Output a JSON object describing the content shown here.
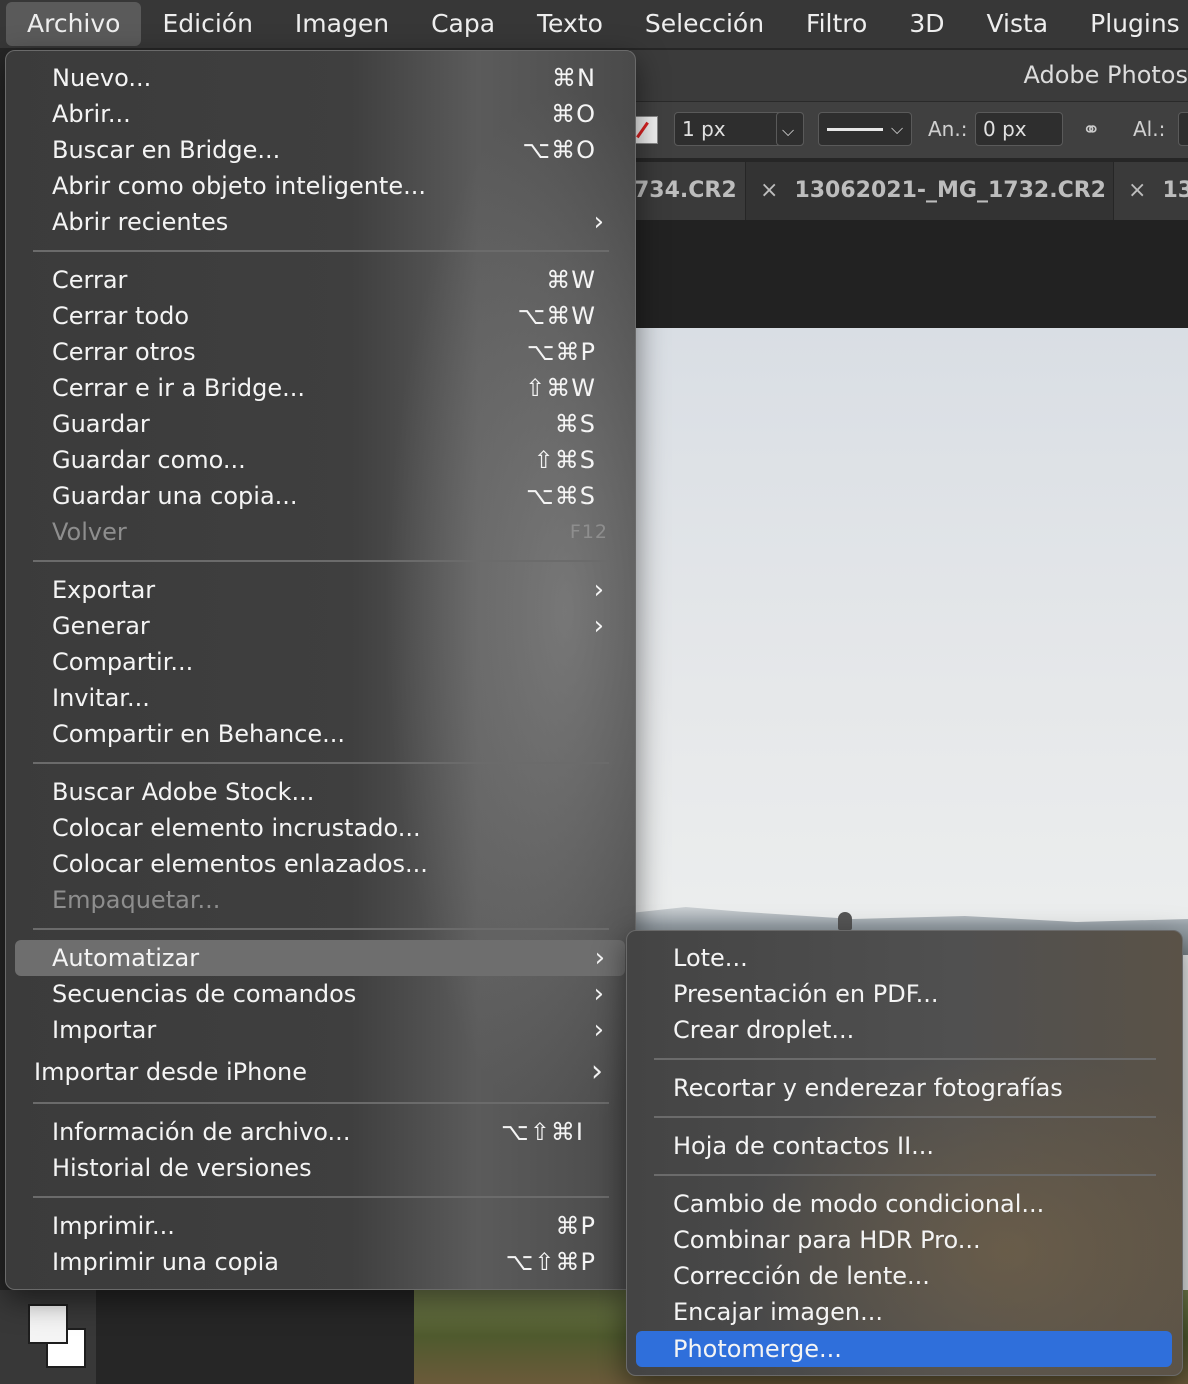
{
  "menubar": {
    "items": [
      "Archivo",
      "Edición",
      "Imagen",
      "Capa",
      "Texto",
      "Selección",
      "Filtro",
      "3D",
      "Vista",
      "Plugins"
    ],
    "active": "Archivo"
  },
  "app": {
    "title": "Adobe Photos",
    "stroke_width": "1 px",
    "width_label": "An.:",
    "width_value": "0 px",
    "height_label": "Al.:",
    "tabs": [
      {
        "close": "",
        "name": "734.CR2"
      },
      {
        "close": "×",
        "name": "13062021-_MG_1732.CR2"
      },
      {
        "close": "×",
        "name": "13"
      }
    ]
  },
  "file_menu": {
    "nuevo": {
      "label": "Nuevo...",
      "shortcut": "⌘N"
    },
    "abrir": {
      "label": "Abrir...",
      "shortcut": "⌘O"
    },
    "buscar_bridge": {
      "label": "Buscar en Bridge...",
      "shortcut": "⌥⌘O"
    },
    "abrir_inteligente": {
      "label": "Abrir como objeto inteligente..."
    },
    "abrir_recientes": {
      "label": "Abrir recientes",
      "arrow": "›"
    },
    "cerrar": {
      "label": "Cerrar",
      "shortcut": "⌘W"
    },
    "cerrar_todo": {
      "label": "Cerrar todo",
      "shortcut": "⌥⌘W"
    },
    "cerrar_otros": {
      "label": "Cerrar otros",
      "shortcut": "⌥⌘P"
    },
    "cerrar_bridge": {
      "label": "Cerrar e ir a Bridge...",
      "shortcut": "⇧⌘W"
    },
    "guardar": {
      "label": "Guardar",
      "shortcut": "⌘S"
    },
    "guardar_como": {
      "label": "Guardar como...",
      "shortcut": "⇧⌘S"
    },
    "guardar_copia": {
      "label": "Guardar una copia...",
      "shortcut": "⌥⌘S"
    },
    "volver": {
      "label": "Volver",
      "shortcut": "F12"
    },
    "exportar": {
      "label": "Exportar",
      "arrow": "›"
    },
    "generar": {
      "label": "Generar",
      "arrow": "›"
    },
    "compartir": {
      "label": "Compartir..."
    },
    "invitar": {
      "label": "Invitar..."
    },
    "behance": {
      "label": "Compartir en Behance..."
    },
    "stock": {
      "label": "Buscar Adobe Stock..."
    },
    "incrustado": {
      "label": "Colocar elemento incrustado..."
    },
    "enlazados": {
      "label": "Colocar elementos enlazados..."
    },
    "empaquetar": {
      "label": "Empaquetar..."
    },
    "automatizar": {
      "label": "Automatizar",
      "arrow": "›"
    },
    "secuencias": {
      "label": "Secuencias de comandos",
      "arrow": "›"
    },
    "importar": {
      "label": "Importar",
      "arrow": "›"
    },
    "iphone": {
      "label": "Importar desde iPhone",
      "arrow": "›"
    },
    "info": {
      "label": "Información de archivo...",
      "shortcut": "⌥⇧⌘I"
    },
    "historial": {
      "label": "Historial de versiones"
    },
    "imprimir": {
      "label": "Imprimir...",
      "shortcut": "⌘P"
    },
    "imprimir_copia": {
      "label": "Imprimir una copia",
      "shortcut": "⌥⇧⌘P"
    }
  },
  "automate_menu": {
    "lote": "Lote...",
    "pdf": "Presentación en PDF...",
    "droplet": "Crear droplet...",
    "recortar": "Recortar y enderezar fotografías",
    "contactos": "Hoja de contactos II...",
    "modo": "Cambio de modo condicional...",
    "hdr": "Combinar para HDR Pro...",
    "lente": "Corrección de lente...",
    "encajar": "Encajar imagen...",
    "photomerge": "Photomerge..."
  },
  "colors": {
    "highlight_blue": "#2f6fdb",
    "menubar_bg": "#373737"
  }
}
